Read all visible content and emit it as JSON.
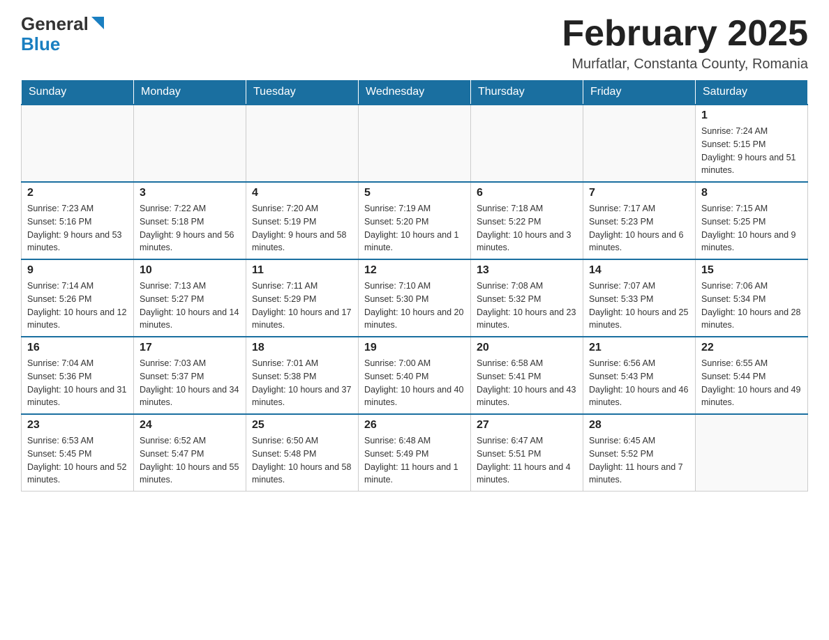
{
  "header": {
    "logo_general": "General",
    "logo_blue": "Blue",
    "month_title": "February 2025",
    "subtitle": "Murfatlar, Constanta County, Romania"
  },
  "days_of_week": [
    "Sunday",
    "Monday",
    "Tuesday",
    "Wednesday",
    "Thursday",
    "Friday",
    "Saturday"
  ],
  "weeks": [
    [
      {
        "day": "",
        "info": ""
      },
      {
        "day": "",
        "info": ""
      },
      {
        "day": "",
        "info": ""
      },
      {
        "day": "",
        "info": ""
      },
      {
        "day": "",
        "info": ""
      },
      {
        "day": "",
        "info": ""
      },
      {
        "day": "1",
        "info": "Sunrise: 7:24 AM\nSunset: 5:15 PM\nDaylight: 9 hours and 51 minutes."
      }
    ],
    [
      {
        "day": "2",
        "info": "Sunrise: 7:23 AM\nSunset: 5:16 PM\nDaylight: 9 hours and 53 minutes."
      },
      {
        "day": "3",
        "info": "Sunrise: 7:22 AM\nSunset: 5:18 PM\nDaylight: 9 hours and 56 minutes."
      },
      {
        "day": "4",
        "info": "Sunrise: 7:20 AM\nSunset: 5:19 PM\nDaylight: 9 hours and 58 minutes."
      },
      {
        "day": "5",
        "info": "Sunrise: 7:19 AM\nSunset: 5:20 PM\nDaylight: 10 hours and 1 minute."
      },
      {
        "day": "6",
        "info": "Sunrise: 7:18 AM\nSunset: 5:22 PM\nDaylight: 10 hours and 3 minutes."
      },
      {
        "day": "7",
        "info": "Sunrise: 7:17 AM\nSunset: 5:23 PM\nDaylight: 10 hours and 6 minutes."
      },
      {
        "day": "8",
        "info": "Sunrise: 7:15 AM\nSunset: 5:25 PM\nDaylight: 10 hours and 9 minutes."
      }
    ],
    [
      {
        "day": "9",
        "info": "Sunrise: 7:14 AM\nSunset: 5:26 PM\nDaylight: 10 hours and 12 minutes."
      },
      {
        "day": "10",
        "info": "Sunrise: 7:13 AM\nSunset: 5:27 PM\nDaylight: 10 hours and 14 minutes."
      },
      {
        "day": "11",
        "info": "Sunrise: 7:11 AM\nSunset: 5:29 PM\nDaylight: 10 hours and 17 minutes."
      },
      {
        "day": "12",
        "info": "Sunrise: 7:10 AM\nSunset: 5:30 PM\nDaylight: 10 hours and 20 minutes."
      },
      {
        "day": "13",
        "info": "Sunrise: 7:08 AM\nSunset: 5:32 PM\nDaylight: 10 hours and 23 minutes."
      },
      {
        "day": "14",
        "info": "Sunrise: 7:07 AM\nSunset: 5:33 PM\nDaylight: 10 hours and 25 minutes."
      },
      {
        "day": "15",
        "info": "Sunrise: 7:06 AM\nSunset: 5:34 PM\nDaylight: 10 hours and 28 minutes."
      }
    ],
    [
      {
        "day": "16",
        "info": "Sunrise: 7:04 AM\nSunset: 5:36 PM\nDaylight: 10 hours and 31 minutes."
      },
      {
        "day": "17",
        "info": "Sunrise: 7:03 AM\nSunset: 5:37 PM\nDaylight: 10 hours and 34 minutes."
      },
      {
        "day": "18",
        "info": "Sunrise: 7:01 AM\nSunset: 5:38 PM\nDaylight: 10 hours and 37 minutes."
      },
      {
        "day": "19",
        "info": "Sunrise: 7:00 AM\nSunset: 5:40 PM\nDaylight: 10 hours and 40 minutes."
      },
      {
        "day": "20",
        "info": "Sunrise: 6:58 AM\nSunset: 5:41 PM\nDaylight: 10 hours and 43 minutes."
      },
      {
        "day": "21",
        "info": "Sunrise: 6:56 AM\nSunset: 5:43 PM\nDaylight: 10 hours and 46 minutes."
      },
      {
        "day": "22",
        "info": "Sunrise: 6:55 AM\nSunset: 5:44 PM\nDaylight: 10 hours and 49 minutes."
      }
    ],
    [
      {
        "day": "23",
        "info": "Sunrise: 6:53 AM\nSunset: 5:45 PM\nDaylight: 10 hours and 52 minutes."
      },
      {
        "day": "24",
        "info": "Sunrise: 6:52 AM\nSunset: 5:47 PM\nDaylight: 10 hours and 55 minutes."
      },
      {
        "day": "25",
        "info": "Sunrise: 6:50 AM\nSunset: 5:48 PM\nDaylight: 10 hours and 58 minutes."
      },
      {
        "day": "26",
        "info": "Sunrise: 6:48 AM\nSunset: 5:49 PM\nDaylight: 11 hours and 1 minute."
      },
      {
        "day": "27",
        "info": "Sunrise: 6:47 AM\nSunset: 5:51 PM\nDaylight: 11 hours and 4 minutes."
      },
      {
        "day": "28",
        "info": "Sunrise: 6:45 AM\nSunset: 5:52 PM\nDaylight: 11 hours and 7 minutes."
      },
      {
        "day": "",
        "info": ""
      }
    ]
  ]
}
